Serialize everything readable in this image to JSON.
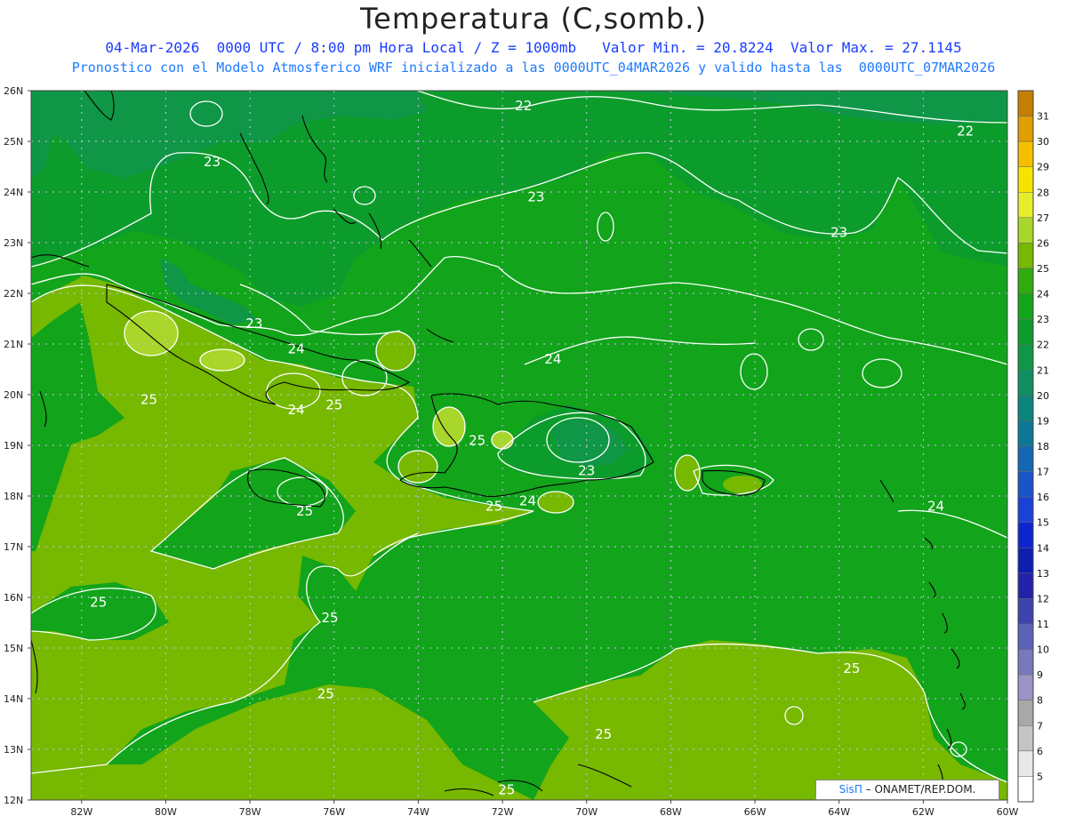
{
  "header": {
    "title": "Temperatura (C,somb.)",
    "subtitle_line1": "04-Mar-2026  0000 UTC / 8:00 pm Hora Local / Z = 1000mb   Valor Min. = 20.8224  Valor Max. = 27.1145",
    "subtitle_line2": "Pronostico con el Modelo Atmosferico WRF inicializado a las 0000UTC_04MAR2026 y valido hasta las  0000UTC_07MAR2026"
  },
  "map": {
    "lat_labels": [
      "26N",
      "25N",
      "24N",
      "23N",
      "22N",
      "21N",
      "20N",
      "19N",
      "18N",
      "17N",
      "16N",
      "15N",
      "14N",
      "13N",
      "12N"
    ],
    "lon_labels": [
      "82W",
      "80W",
      "78W",
      "76W",
      "74W",
      "72W",
      "70W",
      "68W",
      "66W",
      "64W",
      "62W",
      "60W"
    ],
    "contour_labels": [
      {
        "text": "22",
        "lon": -71.5,
        "lat": 25.7
      },
      {
        "text": "22",
        "lon": -61.0,
        "lat": 25.2
      },
      {
        "text": "23",
        "lon": -78.9,
        "lat": 24.6
      },
      {
        "text": "23",
        "lon": -71.2,
        "lat": 23.9
      },
      {
        "text": "23",
        "lon": -64.0,
        "lat": 23.2
      },
      {
        "text": "23",
        "lon": -77.9,
        "lat": 21.4
      },
      {
        "text": "24",
        "lon": -76.9,
        "lat": 20.9
      },
      {
        "text": "24",
        "lon": -70.8,
        "lat": 20.7
      },
      {
        "text": "25",
        "lon": -80.4,
        "lat": 19.9
      },
      {
        "text": "24",
        "lon": -76.9,
        "lat": 19.7
      },
      {
        "text": "25",
        "lon": -76.0,
        "lat": 19.8
      },
      {
        "text": "25",
        "lon": -72.6,
        "lat": 19.1
      },
      {
        "text": "23",
        "lon": -70.0,
        "lat": 18.5
      },
      {
        "text": "24",
        "lon": -71.4,
        "lat": 17.9
      },
      {
        "text": "25",
        "lon": -72.2,
        "lat": 17.8
      },
      {
        "text": "25",
        "lon": -76.7,
        "lat": 17.7
      },
      {
        "text": "24",
        "lon": -61.7,
        "lat": 17.8
      },
      {
        "text": "25",
        "lon": -81.6,
        "lat": 15.9
      },
      {
        "text": "25",
        "lon": -76.1,
        "lat": 15.6
      },
      {
        "text": "25",
        "lon": -63.7,
        "lat": 14.6
      },
      {
        "text": "25",
        "lon": -76.2,
        "lat": 14.1
      },
      {
        "text": "25",
        "lon": -69.6,
        "lat": 13.3
      },
      {
        "text": "25",
        "lon": -71.9,
        "lat": 12.2
      }
    ]
  },
  "colorbar": {
    "levels": [
      "31",
      "30",
      "29",
      "28",
      "27",
      "26",
      "25",
      "24",
      "23",
      "22",
      "21",
      "20",
      "19",
      "18",
      "17",
      "16",
      "15",
      "14",
      "13",
      "12",
      "11",
      "10",
      "9",
      "8",
      "7",
      "6",
      "5"
    ],
    "colors": [
      "#c47f00",
      "#e09e00",
      "#f5bf00",
      "#f6e400",
      "#e6ee2c",
      "#a8d62a",
      "#77b800",
      "#2fac0c",
      "#12a41b",
      "#0c9c2c",
      "#0f9646",
      "#0f8e60",
      "#0c857c",
      "#0c7896",
      "#1367b4",
      "#1a55c8",
      "#1b42d6",
      "#0d25cf",
      "#0c1fb0",
      "#2223a8",
      "#3d44ae",
      "#5a63b6",
      "#7878be",
      "#9b94c6",
      "#a8a8a8",
      "#c4c4c4",
      "#e8e8e8",
      "#ffffff"
    ]
  },
  "credit": {
    "brand": "SisΠ",
    "text": " – ONAMET/REP.DOM."
  }
}
